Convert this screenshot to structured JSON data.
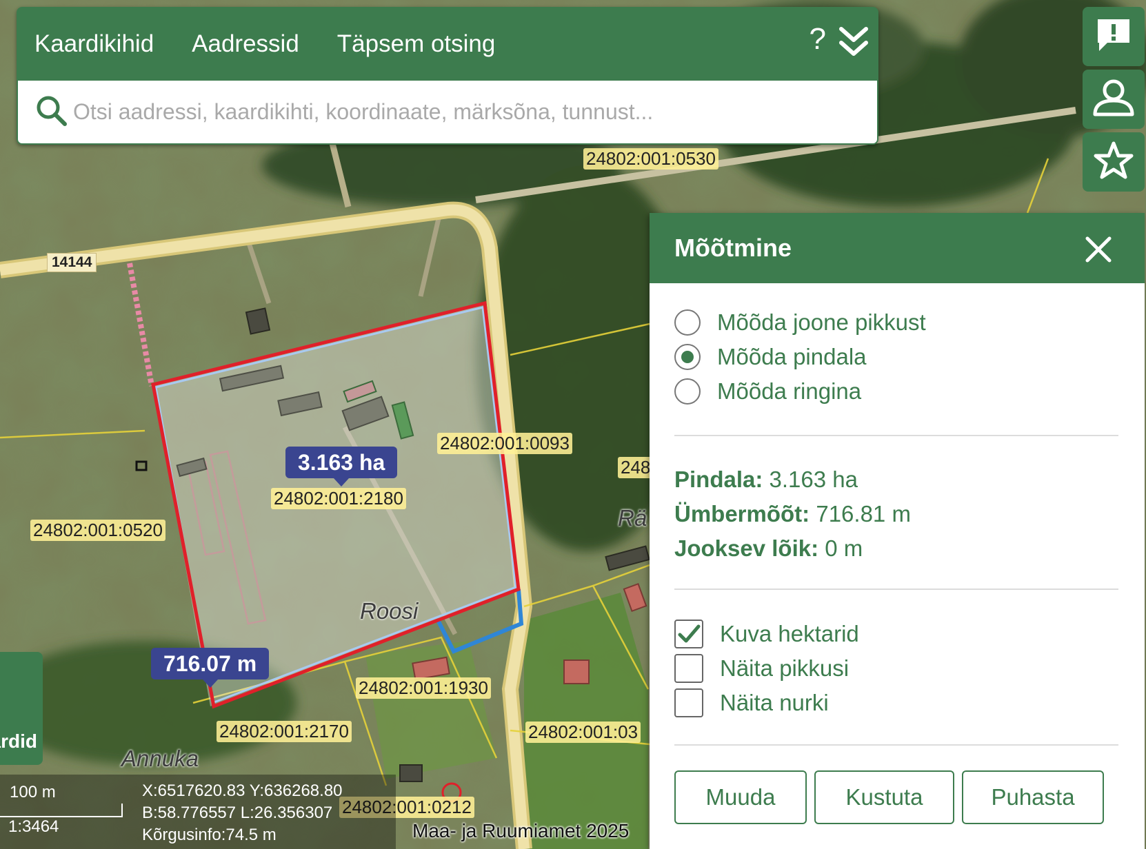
{
  "topbar": {
    "tabs": [
      "Kaardikihid",
      "Aadressid",
      "Täpsem otsing"
    ],
    "help_label": "?",
    "search_placeholder": "Otsi aadressi, kaardikihti, koordinaate, märksõna, tunnust..."
  },
  "tools": [
    "feedback-icon",
    "user-icon",
    "star-icon"
  ],
  "map": {
    "parcel_labels": [
      "24802:001:0530",
      "24802:001:0093",
      "24802:001:2180",
      "24802:001:0520",
      "24802:001:1930",
      "24802:001:2170",
      "24802:001:03",
      "24802:001:0212",
      "248"
    ],
    "road_number": "14144",
    "place_names": [
      "Roosi",
      "Annuka",
      "Rä"
    ],
    "area_tooltip": "3.163 ha",
    "length_tooltip": "716.07 m",
    "colors": {
      "measure_outline": "#e0202a",
      "measure_segment": "#2f86d6",
      "parcel_lines": "#e6d23a",
      "accent": "#3d7c4e"
    }
  },
  "panel": {
    "title": "Mõõtmine",
    "modes": [
      {
        "label": "Mõõda joone pikkust",
        "selected": false
      },
      {
        "label": "Mõõda pindala",
        "selected": true
      },
      {
        "label": "Mõõda ringina",
        "selected": false
      }
    ],
    "results": {
      "area_key": "Pindala:",
      "area_val": "3.163 ha",
      "perimeter_key": "Ümbermõõt:",
      "perimeter_val": "716.81 m",
      "segment_key": "Jooksev lõik:",
      "segment_val": "0 m"
    },
    "options": [
      {
        "label": "Kuva hektarid",
        "checked": true
      },
      {
        "label": "Näita pikkusi",
        "checked": false
      },
      {
        "label": "Näita nurki",
        "checked": false
      }
    ],
    "buttons": [
      "Muuda",
      "Kustuta",
      "Puhasta"
    ]
  },
  "footer": {
    "maps_tab_label": "ardid",
    "scale_distance": "100 m",
    "scale_ratio": "1:3464",
    "coord_xy": "X:6517620.83 Y:636268.80",
    "coord_bl": "B:58.776557 L:26.356307",
    "elevation": "Kõrgusinfo:74.5 m",
    "attribution": "Maa- ja Ruumiamet 2025"
  }
}
